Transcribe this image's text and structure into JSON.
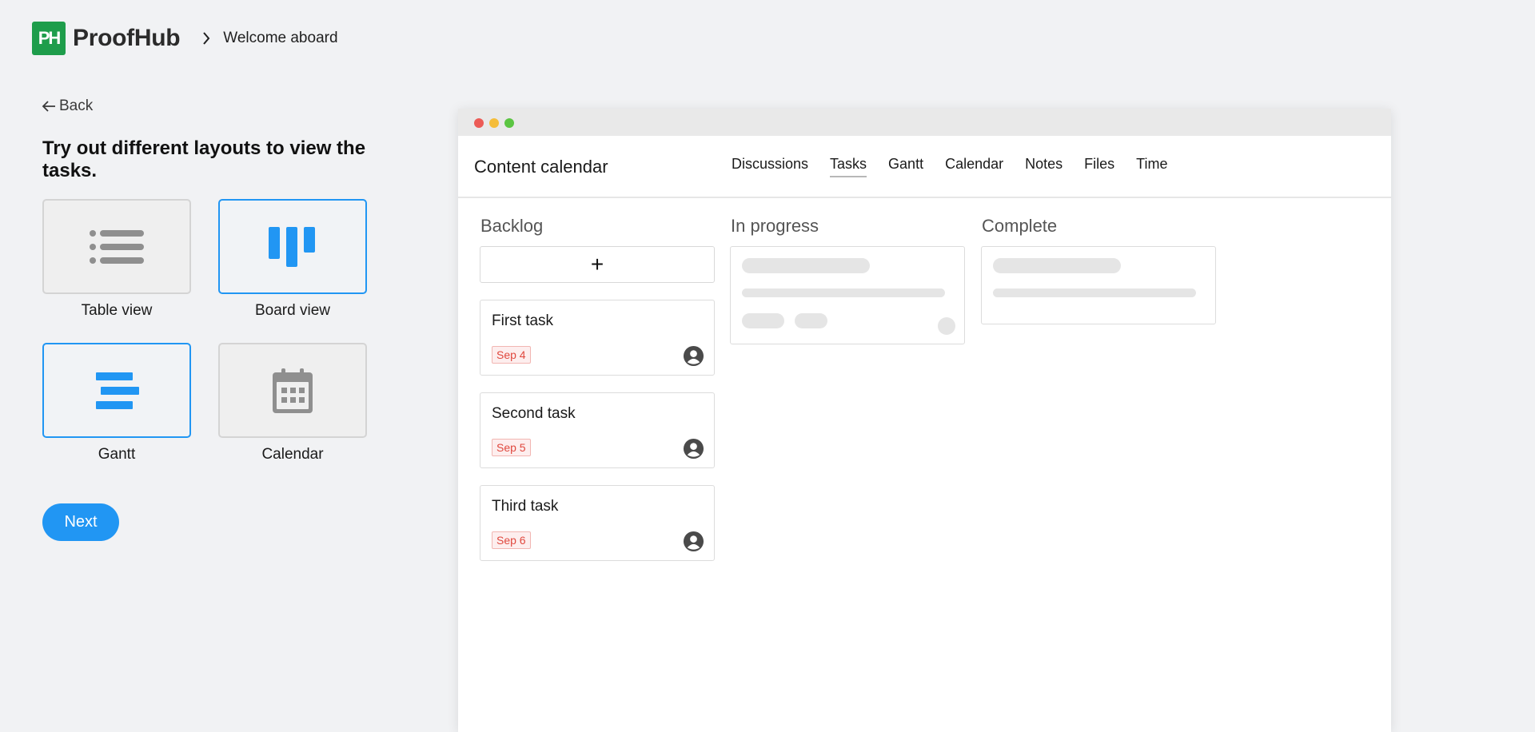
{
  "header": {
    "logo_mark": "PH",
    "logo_text": "ProofHub",
    "breadcrumb": "Welcome aboard"
  },
  "left": {
    "back_label": "Back",
    "heading": "Try out different layouts to view the tasks.",
    "layouts": [
      {
        "label": "Table view",
        "icon": "list-icon",
        "selected": false
      },
      {
        "label": "Board view",
        "icon": "board-icon",
        "selected": true
      },
      {
        "label": "Gantt",
        "icon": "gantt-icon",
        "selected": true
      },
      {
        "label": "Calendar",
        "icon": "calendar-icon",
        "selected": false
      }
    ],
    "next_label": "Next"
  },
  "preview": {
    "project_title": "Content calendar",
    "tabs": [
      {
        "label": "Discussions",
        "active": false
      },
      {
        "label": "Tasks",
        "active": true
      },
      {
        "label": "Gantt",
        "active": false
      },
      {
        "label": "Calendar",
        "active": false
      },
      {
        "label": "Notes",
        "active": false
      },
      {
        "label": "Files",
        "active": false
      },
      {
        "label": "Time",
        "active": false
      }
    ],
    "columns": [
      {
        "title": "Backlog",
        "add_symbol": "+",
        "tasks": [
          {
            "title": "First task",
            "due": "Sep 4"
          },
          {
            "title": "Second task",
            "due": "Sep 5"
          },
          {
            "title": "Third task",
            "due": "Sep 6"
          }
        ]
      },
      {
        "title": "In progress"
      },
      {
        "title": "Complete"
      }
    ]
  },
  "colors": {
    "accent": "#2196f3",
    "brand_green": "#1e9d4b",
    "due_red": "#e0483e",
    "background": "#f1f2f4"
  }
}
